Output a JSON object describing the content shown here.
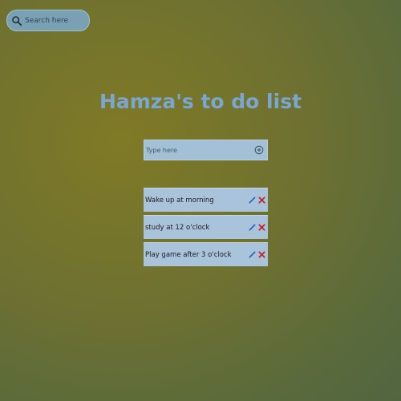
{
  "search": {
    "placeholder": "Search here",
    "icon": "search-icon"
  },
  "page": {
    "title": "Hamza's to do list"
  },
  "entry": {
    "placeholder": "Type here",
    "add_icon": "plus-circle-icon"
  },
  "tasks": [
    {
      "text": "Wake up at morning",
      "edit_icon": "pencil-icon",
      "delete_icon": "close-icon"
    },
    {
      "text": "study at 12 o'clock",
      "edit_icon": "pencil-icon",
      "delete_icon": "close-icon"
    },
    {
      "text": "Play game after 3 o'clock",
      "edit_icon": "pencil-icon",
      "delete_icon": "close-icon"
    }
  ],
  "colors": {
    "background": "#6f7130",
    "title": "#7aa6cf",
    "input_background": "#a3c0d6",
    "task_background": "#a9c4da",
    "edit_icon": "#1f5fb4",
    "delete_icon": "#c0262b"
  }
}
